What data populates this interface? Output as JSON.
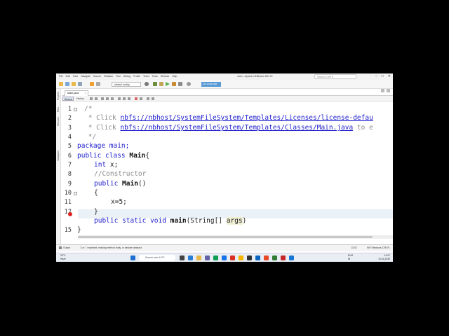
{
  "window": {
    "title": "main - Apache NetBeans IDE 20",
    "menu": [
      "File",
      "Edit",
      "View",
      "Navigate",
      "Source",
      "Refactor",
      "Run",
      "Debug",
      "Profile",
      "Team",
      "Tools",
      "Window",
      "Help"
    ],
    "search_placeholder": "Search (Ctrl+I)",
    "controls": [
      "–",
      "□",
      "✕"
    ]
  },
  "toolbar": {
    "config": "<default config>",
    "memory": "190.0/283.0MB"
  },
  "side_panels": [
    "Projects",
    "Files",
    "Services",
    "Navigator"
  ],
  "editor": {
    "tab": "Main.java",
    "source_btn": "Source",
    "history_btn": "History",
    "lines": [
      {
        "n": "1"
      },
      {
        "n": "2"
      },
      {
        "n": "3"
      },
      {
        "n": "4"
      },
      {
        "n": "5"
      },
      {
        "n": "6"
      },
      {
        "n": "7"
      },
      {
        "n": "8"
      },
      {
        "n": "9"
      },
      {
        "n": "10"
      },
      {
        "n": "11"
      },
      {
        "n": "12"
      },
      {
        "n": "13"
      },
      {
        "n": "14"
      },
      {
        "n": "15"
      }
    ],
    "code": {
      "l1": "/*",
      "l2_prefix": " * Click ",
      "l2_link": "nbfs://nbhost/SystemFileSystem/Templates/Licenses/license-defau",
      "l3_prefix": " * Click ",
      "l3_link": "nbfs://nbhost/SystemFileSystem/Templates/Classes/Main.java",
      "l3_suffix": " to e",
      "l4": " */",
      "l5": "package main;",
      "l6_kw": "public class ",
      "l6_name": "Main",
      "l6_end": "{",
      "l7_kw": "int",
      "l7_rest": " x;",
      "l8": "//Constructor",
      "l9_kw": "public ",
      "l9_name": "Main",
      "l9_end": "()",
      "l10": "{",
      "l11": "x=5;",
      "l12": "}",
      "l13_kw": "public static void ",
      "l13_name": "main",
      "l13_rest": "(String[] ",
      "l13_arg": "args",
      "l13_end": ")",
      "l14": "}"
    }
  },
  "status": {
    "output_tab": "Output",
    "message": "'{' or ';' expected; missing method body, or declare abstract",
    "position": "13:42",
    "encoding": "INS Windows (CRLF)"
  },
  "taskbar": {
    "weather_temp": "29°C",
    "weather_desc": "Haze",
    "search": "Search web & PC",
    "lang": "ENG",
    "lang2": "IN",
    "time": "10:07",
    "date": "10-04-2025"
  },
  "colors": {
    "keyword": "#1c1ccd",
    "comment": "#8a8a8a",
    "error": "#d22222",
    "highlight": "#eaf1f7"
  }
}
